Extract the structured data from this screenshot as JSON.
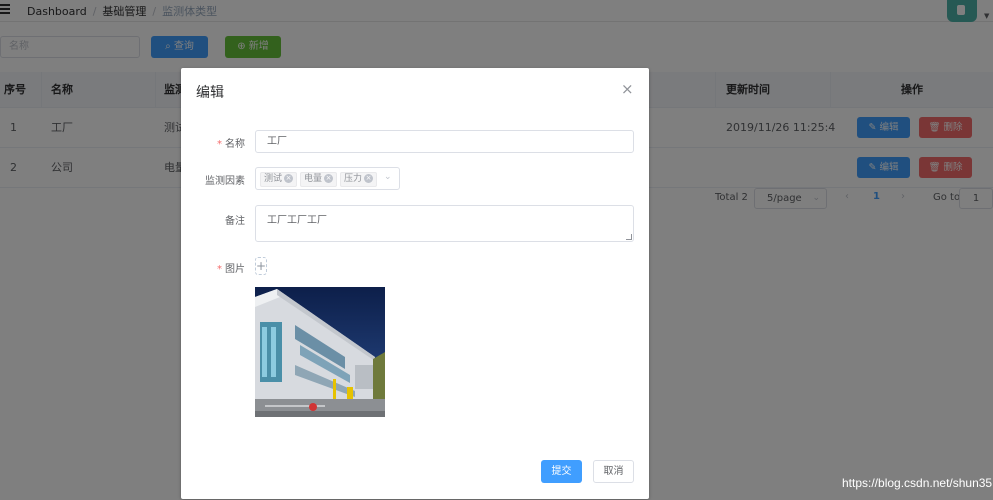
{
  "breadcrumb": [
    "Dashboard",
    "基础管理",
    "监测体类型"
  ],
  "filter": {
    "placeholder": "名称",
    "query_label": "查询",
    "add_label": "新增"
  },
  "table": {
    "headers": [
      "序号",
      "名称",
      "监测",
      "更新时间",
      "操作"
    ],
    "rows": [
      {
        "index": "1",
        "name": "工厂",
        "factor": "测试",
        "updated": "2019/11/26 11:25:4"
      },
      {
        "index": "2",
        "name": "公司",
        "factor": "电量",
        "updated": ""
      }
    ],
    "edit_label": "编辑",
    "delete_label": "删除"
  },
  "pagination": {
    "total": "Total 2",
    "page_size": "5/page",
    "current": "1",
    "goto_label": "Go to",
    "goto_value": "1"
  },
  "dialog": {
    "title": "编辑",
    "name_label": "名称",
    "name_value": "工厂",
    "factors_label": "监测因素",
    "factors": [
      "测试",
      "电量",
      "压力"
    ],
    "remark_label": "备注",
    "remark_value": "工厂工厂工厂",
    "image_label": "图片",
    "submit_label": "提交",
    "cancel_label": "取消"
  },
  "watermark": "https://blog.csdn.net/shun35",
  "colors": {
    "primary": "#409eff",
    "success": "#67c23a",
    "danger": "#f56c6c",
    "required": "#f56c6c",
    "avatar": "#4db3a8"
  }
}
